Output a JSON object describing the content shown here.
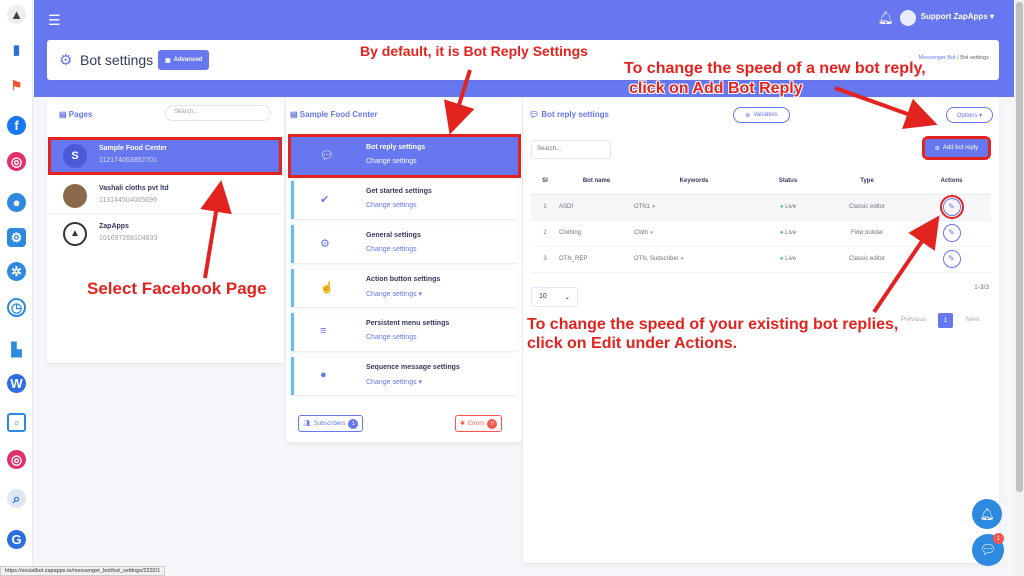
{
  "topbar": {
    "user_name": "Support ZapApps ▾"
  },
  "header": {
    "title": "Bot settings",
    "advanced_label": "Advanced",
    "breadcrumb_link": "Messenger Bot",
    "breadcrumb_sep": "/",
    "breadcrumb_current": "Bot settings"
  },
  "pages_panel": {
    "title": "Pages",
    "search_placeholder": "Search...",
    "items": [
      {
        "name": "Sample Food Center",
        "id": "112174063852701",
        "avatar": "S"
      },
      {
        "name": "Vashali cloths pvt ltd",
        "id": "113144504005699"
      },
      {
        "name": "ZapApps",
        "id": "101697268104633"
      }
    ]
  },
  "settings_panel": {
    "title": "Sample Food Center",
    "items": [
      {
        "title": "Bot reply settings",
        "sub": "Change settings"
      },
      {
        "title": "Get started settings",
        "sub": "Change settings"
      },
      {
        "title": "General settings",
        "sub": "Change settings"
      },
      {
        "title": "Action button settings",
        "sub": "Change settings ▾"
      },
      {
        "title": "Persistent menu settings",
        "sub": "Change settings"
      },
      {
        "title": "Sequence message settings",
        "sub": "Change settings ▾"
      }
    ],
    "subscribers_label": "Subscribers",
    "subscribers_count": "1",
    "errors_label": "Errors",
    "errors_count": "0"
  },
  "reply_panel": {
    "title": "Bot reply settings",
    "variables_label": "Variables",
    "options_label": "Options ▾",
    "search_placeholder": "Search...",
    "add_label": "Add bot reply",
    "columns": [
      "Sl",
      "Bot name",
      "Keywords",
      "Status",
      "Type",
      "Actions"
    ],
    "rows": [
      {
        "sl": "1",
        "name": "ASDf",
        "keywords": "OTN1",
        "status": "Live",
        "type": "Classic editor"
      },
      {
        "sl": "2",
        "name": "Clothing",
        "keywords": "Cloth",
        "status": "Live",
        "type": "Flow builder"
      },
      {
        "sl": "3",
        "name": "OTN_REP",
        "keywords": "OTN, Subscriber",
        "status": "Live",
        "type": "Classic editor"
      }
    ],
    "page_length": "10",
    "count_text": "1-3/3",
    "previous": "Previous",
    "current_page": "1",
    "next": "Next"
  },
  "annotations": {
    "default_note": "By default, it is Bot Reply Settings",
    "select_page": "Select Facebook Page",
    "new_speed_1": "To change the speed of a new bot reply,",
    "new_speed_2": "click on Add Bot Reply",
    "edit_speed_1": "To change the speed of your existing bot replies,",
    "edit_speed_2": "click on Edit under Actions."
  },
  "status_url": "https://socialbot.zapapps.io/messenger_bot/bot_settings/2332/1",
  "chat_badge": "1",
  "colors": {
    "primary": "#6777ef",
    "annotation": "#e3231f",
    "live": "#47c363"
  }
}
